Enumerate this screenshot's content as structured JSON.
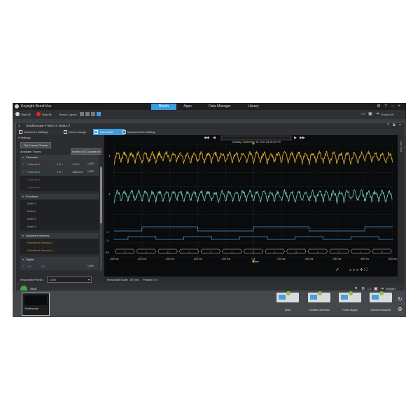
{
  "app": {
    "title": "Keysight BenchVue",
    "tabs": [
      {
        "label": "Bench",
        "active": true
      },
      {
        "label": "Apps",
        "active": false
      },
      {
        "label": "Data Manager",
        "active": false
      },
      {
        "label": "Library",
        "active": false
      }
    ]
  },
  "toolbar": {
    "start_all": "Start All",
    "stop_all": "Stop All",
    "bench_layout": "Bench Layout:",
    "export_all": "Export All"
  },
  "instrument": {
    "number": "1",
    "title": "Oscilloscope // MSO-X 4034A //",
    "subtabs": [
      {
        "label": "Instrument Settings",
        "active": false
      },
      {
        "label": "Screen Image",
        "active": false
      },
      {
        "label": "Trace Data",
        "active": true
      },
      {
        "label": "Measurement Datalog",
        "active": false
      }
    ]
  },
  "settings": {
    "header": "Settings",
    "get_traces_button": "Get Current Traces",
    "available_traces": "Available Traces:",
    "enable_all": "Enable All",
    "disable_all": "Disable All",
    "sections": {
      "channels": "Channels",
      "functions": "Functions",
      "waveform_memory": "Waveform Memory",
      "digital": "Digital"
    },
    "channels": [
      {
        "name": "Channel 1",
        "scale": "1 V /",
        "offset": "-2.5 V",
        "points": "1,000",
        "color": "#e8b830",
        "checked": true
      },
      {
        "name": "Channel 2",
        "scale": "1 V /",
        "offset": "-500 mV",
        "points": "1,000",
        "color": "#6fd3b8",
        "checked": true
      },
      {
        "name": "Channel 3",
        "color": "#7b6a88",
        "checked": false
      },
      {
        "name": "Channel 4",
        "color": "#7b6a88",
        "checked": false
      }
    ],
    "maths": [
      "Math 1",
      "Math 2",
      "Math 3",
      "Math 4"
    ],
    "memories": [
      "Waveform Memory 1",
      "Waveform Memory 2"
    ],
    "digital": {
      "name": "Dbl",
      "value": "D0",
      "points": "1,000"
    },
    "requested_points_label": "Requested Points:",
    "requested_points_value": "1,000"
  },
  "plot": {
    "timestamp": "Tuesday, September 30, 2014 08:16:54 PM",
    "x_ticks": [
      "-500 ms",
      "-400 ms",
      "-300 ms",
      "-200 ms",
      "-100 ms",
      "0 s",
      "100 ms",
      "200 ms",
      "300 ms",
      "400 ms",
      "500 ms"
    ],
    "x_title": "Time",
    "ch1_label": "1",
    "ch2_label": "2",
    "d1_label": "D1",
    "d0_label": "D0",
    "b1_label": "B1",
    "side_label": "Data Tools",
    "horizontal_scale_label": "Horizontal Scale:",
    "horizontal_scale_value": "100 ms",
    "position_label": "Position:",
    "position_value": "0 s",
    "bus_values": [
      "0",
      "1",
      "0",
      "1",
      "0",
      "1",
      "0",
      "1",
      "0",
      "1",
      "0",
      "1",
      "0"
    ],
    "colors": {
      "ch1": "#e8b830",
      "ch2": "#6fd3b8",
      "digital": "#3d9be0",
      "grid": "#2f3236",
      "trigger": "#f0a020"
    }
  },
  "footer": {
    "start_button": "Start",
    "export": "Export"
  },
  "dock": {
    "active_thumbnail": "Oscilloscope",
    "instruments": [
      {
        "label": "DMM",
        "icon": "dmm-icon"
      },
      {
        "label": "Function Generator",
        "icon": "function-generator-icon"
      },
      {
        "label": "Power Supply",
        "icon": "power-supply-icon"
      },
      {
        "label": "Spectrum Analyzer",
        "icon": "spectrum-analyzer-icon"
      }
    ]
  }
}
